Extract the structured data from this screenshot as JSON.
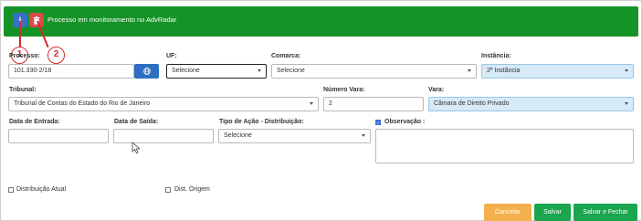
{
  "banner": {
    "info_icon": "info-icon",
    "trash_icon": "trash-icon",
    "text": "Processo em monitoramento no AdvRadar",
    "color": "#159326"
  },
  "callouts": [
    "1",
    "2"
  ],
  "form": {
    "processo": {
      "label": "Processo:",
      "value": "101.330-2/18",
      "button_icon": "globe-icon"
    },
    "uf": {
      "label": "UF:",
      "value": "Selecione"
    },
    "comarca": {
      "label": "Comarca:",
      "value": "Selecione"
    },
    "instancia": {
      "label": "Instância:",
      "value": "2ª Instância"
    },
    "tribunal": {
      "label": "Tribunal:",
      "value": "Tribunal de Contas do Estado do Rio de Janeiro"
    },
    "numero_vara": {
      "label": "Número Vara:",
      "value": "2"
    },
    "vara": {
      "label": "Vara:",
      "value": "Câmara de Direito Privado"
    },
    "data_entrada": {
      "label": "Data de Entrada:",
      "value": ""
    },
    "data_saida": {
      "label": "Data de Saída:",
      "value": ""
    },
    "tipo_acao": {
      "label": "Tipo de Ação - Distribuição:",
      "value": "Selecione"
    },
    "observacao": {
      "label": "Observação :",
      "checked": true,
      "value": ""
    },
    "distribuicao_atual": {
      "label": "Distribuição Atual",
      "checked": false
    },
    "dist_origem": {
      "label": "Dist. Origem",
      "checked": false
    }
  },
  "actions": {
    "cancel": "Cancelar",
    "save": "Salvar",
    "save_close": "Salvar e Fechar"
  },
  "colors": {
    "cancel": "#f3b04c",
    "save": "#1aa54e",
    "blue_select": "#d6eaf8",
    "callout": "#d42b2b"
  }
}
